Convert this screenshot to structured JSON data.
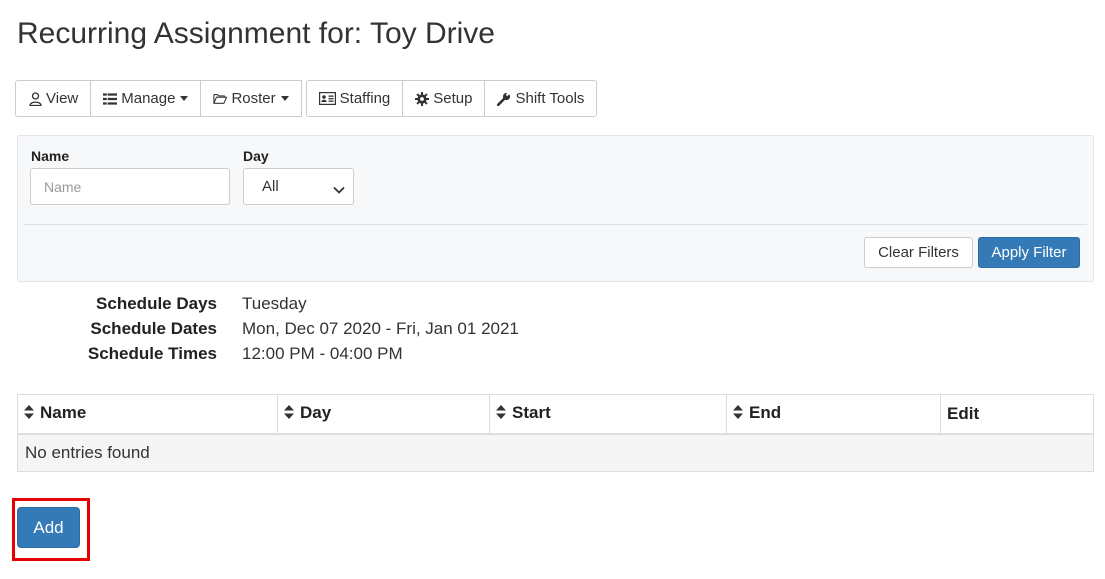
{
  "page": {
    "title": "Recurring Assignment for: Toy Drive"
  },
  "toolbar": {
    "view": "View",
    "manage": "Manage",
    "roster": "Roster",
    "staffing": "Staffing",
    "setup": "Setup",
    "shift_tools": "Shift Tools"
  },
  "filter": {
    "name_label": "Name",
    "name_placeholder": "Name",
    "name_value": "",
    "day_label": "Day",
    "day_selected": "All",
    "clear_label": "Clear Filters",
    "apply_label": "Apply Filter"
  },
  "schedule": {
    "days_label": "Schedule Days",
    "days_value": "Tuesday",
    "dates_label": "Schedule Dates",
    "dates_value": "Mon, Dec 07 2020 - Fri, Jan 01 2021",
    "times_label": "Schedule Times",
    "times_value": "12:00 PM - 04:00 PM"
  },
  "table": {
    "columns": [
      "Name",
      "Day",
      "Start",
      "End",
      "Edit"
    ],
    "empty_message": "No entries found"
  },
  "actions": {
    "add_label": "Add"
  },
  "colors": {
    "primary": "#337ab7",
    "highlight": "#e60000"
  }
}
